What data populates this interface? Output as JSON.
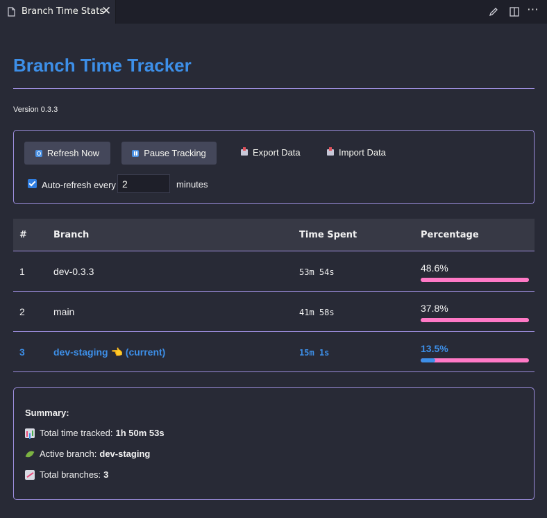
{
  "tab": {
    "title": "Branch Time Stats",
    "close": "✕"
  },
  "toolbar": {
    "more": "⋯"
  },
  "header": {
    "title": "Branch Time Tracker",
    "version": "Version 0.3.3"
  },
  "controls": {
    "refresh_label": "Refresh Now",
    "pause_label": "Pause Tracking",
    "export_label": "Export Data",
    "import_label": "Import Data",
    "auto_refresh_label": "Auto-refresh every",
    "auto_refresh_checked": true,
    "interval_value": "2",
    "minutes_label": "minutes"
  },
  "table": {
    "headers": {
      "num": "#",
      "branch": "Branch",
      "time": "Time Spent",
      "percentage": "Percentage"
    },
    "rows": [
      {
        "num": "1",
        "branch": "dev-0.3.3",
        "time": "53m 54s",
        "percentage": "48.6%",
        "fraction": 1.0,
        "current": false
      },
      {
        "num": "2",
        "branch": "main",
        "time": "41m 58s",
        "percentage": "37.8%",
        "fraction": 1.0,
        "current": false
      },
      {
        "num": "3",
        "branch": "dev-staging 👈 (current)",
        "time": "15m 1s",
        "percentage": "13.5%",
        "fraction": 0.135,
        "current": true
      }
    ]
  },
  "summary": {
    "heading": "Summary:",
    "total_label": "Total time tracked:",
    "total_value": "1h 50m 53s",
    "active_label": "Active branch:",
    "active_value": "dev-staging",
    "branches_label": "Total branches:",
    "branches_value": "3"
  },
  "colors": {
    "accent": "#3d8fe8",
    "bar": "#ff79c6",
    "border": "#9e8fe0",
    "background": "#282a36"
  }
}
